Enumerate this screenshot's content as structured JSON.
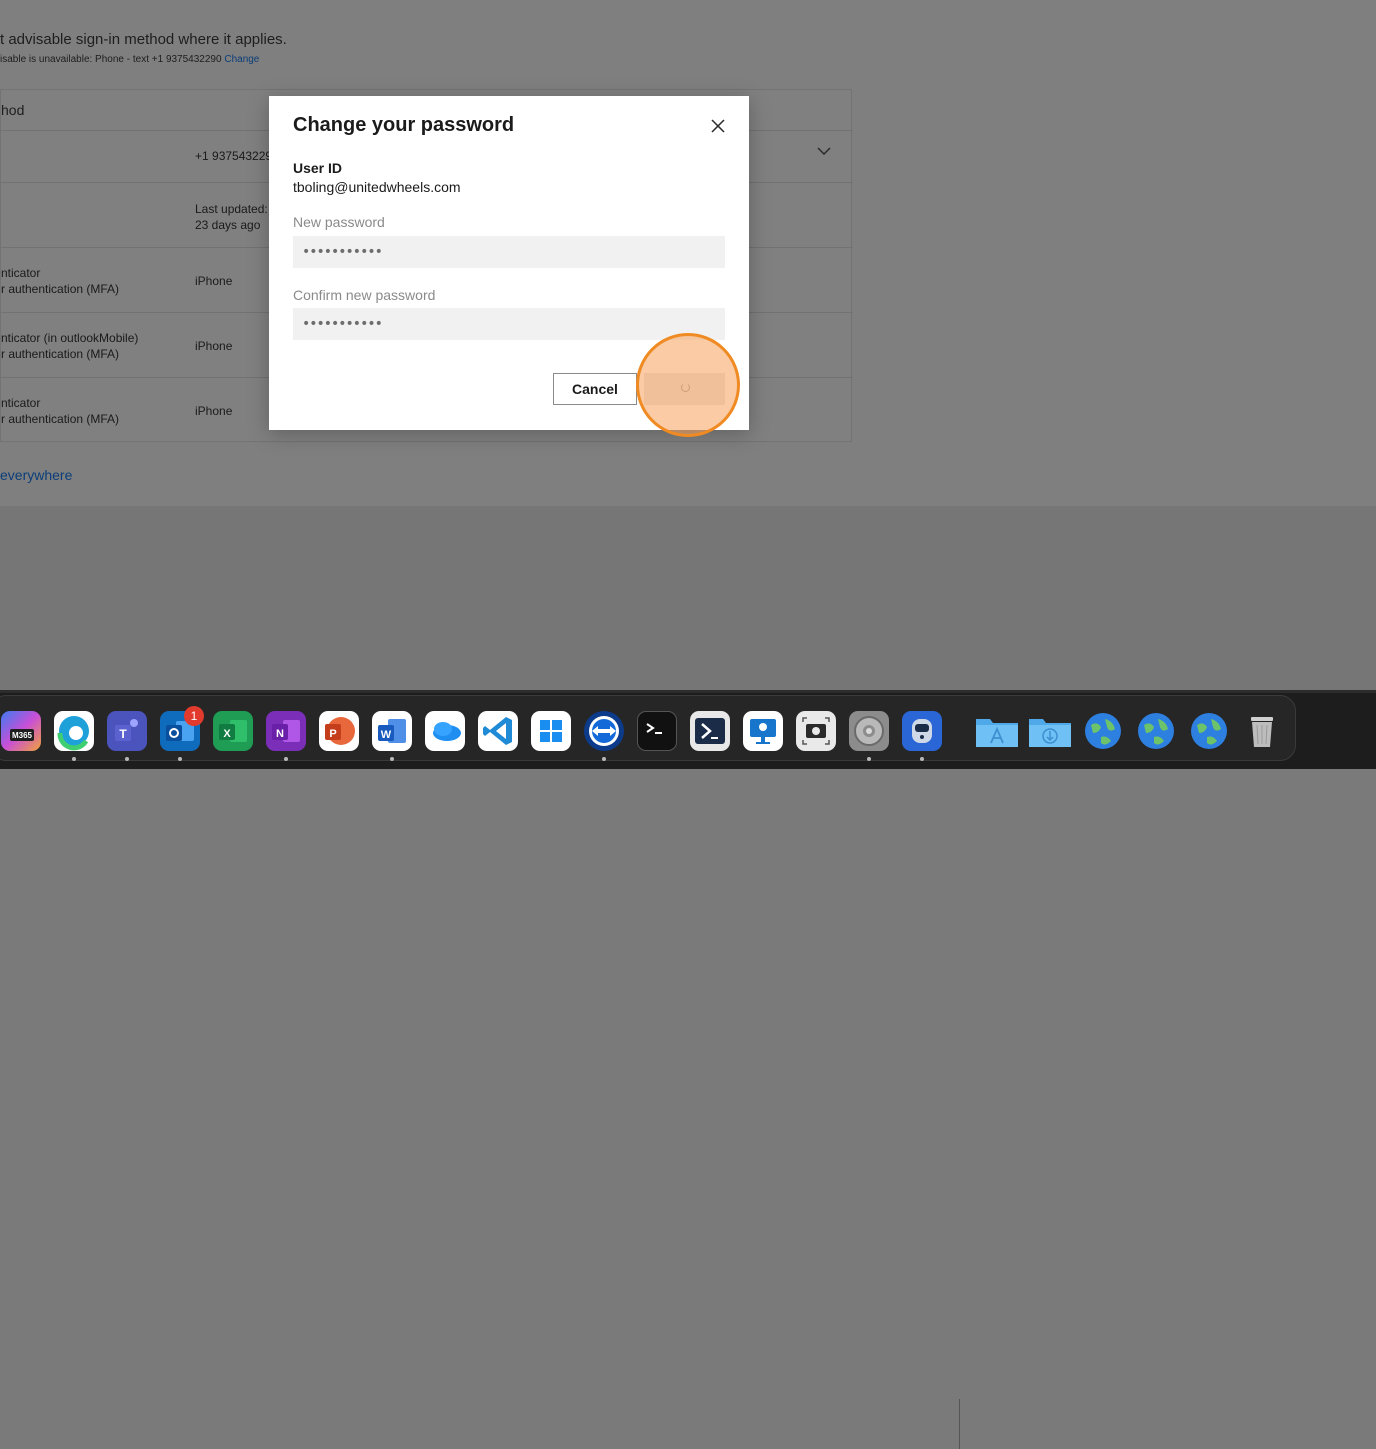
{
  "background": {
    "line1": "t advisable sign-in method where it applies.",
    "line2_prefix": "isable is unavailable: Phone - text +1 9375432290",
    "line2_link": "Change",
    "card_header": "hod",
    "rows": [
      {
        "name1": "",
        "name2": "",
        "detail1": "+1 937543229",
        "detail2": ""
      },
      {
        "name1": "",
        "name2": "",
        "detail1": "Last updated:",
        "detail2": "23 days ago"
      },
      {
        "name1": "nticator",
        "name2": "r authentication (MFA)",
        "detail1": "iPhone",
        "detail2": ""
      },
      {
        "name1": "nticator (in outlookMobile)",
        "name2": "r authentication (MFA)",
        "detail1": "iPhone",
        "detail2": ""
      },
      {
        "name1": "nticator",
        "name2": "r authentication (MFA)",
        "detail1": "iPhone",
        "detail2": ""
      }
    ],
    "signout_link": "everywhere"
  },
  "dialog": {
    "title": "Change your password",
    "user_id_label": "User ID",
    "user_id_value": "tboling@unitedwheels.com",
    "new_password_label": "New password",
    "new_password_value": "•••••••••••",
    "confirm_password_label": "Confirm new password",
    "confirm_password_value": "•••••••••••",
    "cancel_label": "Cancel"
  },
  "dock": {
    "apps": [
      "m365-icon",
      "edge-icon",
      "teams-icon",
      "outlook-icon",
      "excel-icon",
      "onenote-icon",
      "powerpoint-icon",
      "word-icon",
      "onedrive-icon",
      "vscode-icon",
      "windows-app-icon",
      "teamviewer-icon",
      "terminal-icon",
      "powershell-icon",
      "remote-desktop-icon",
      "screenshot-icon",
      "system-settings-icon",
      "privileges-icon",
      "applications-folder-icon",
      "downloads-folder-icon",
      "globe-icon-1",
      "globe-icon-2",
      "globe-icon-3",
      "trash-icon"
    ],
    "outlook_badge": "1",
    "m365_text": "M365"
  },
  "colors": {
    "accent_link": "#0b3e78",
    "click_ring": "#f08a22"
  }
}
